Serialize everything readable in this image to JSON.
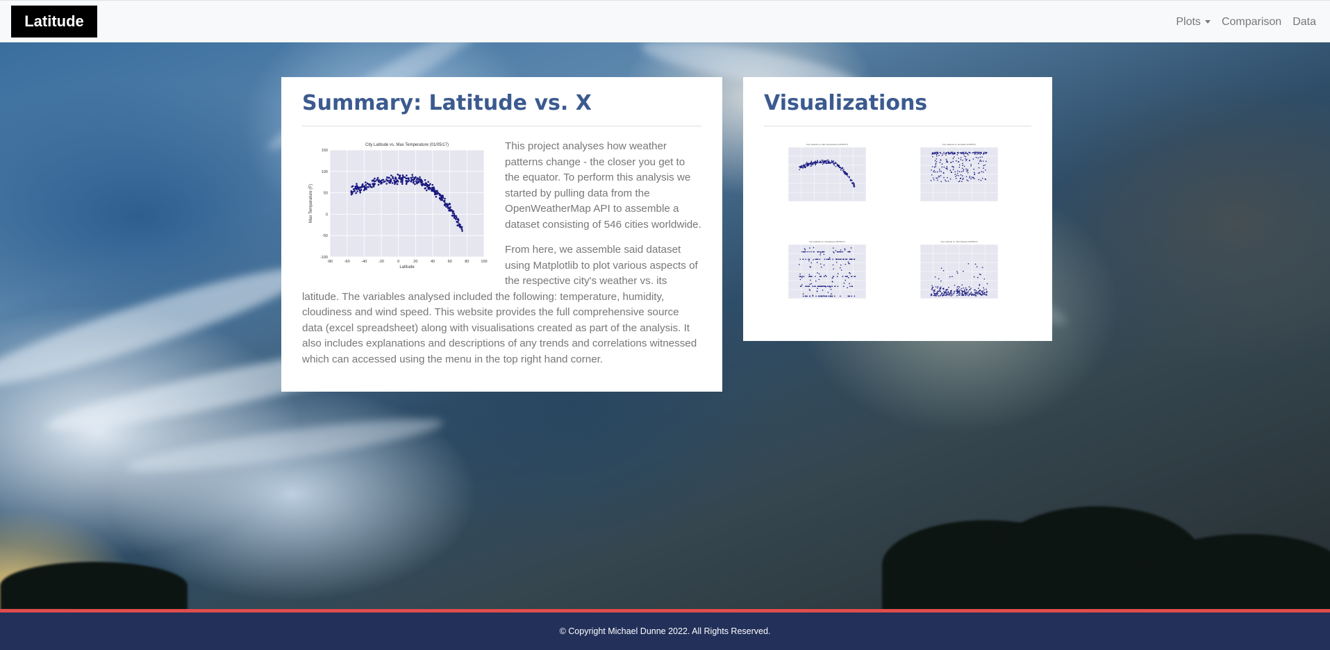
{
  "navbar": {
    "brand": "Latitude",
    "links": [
      {
        "label": "Plots",
        "has_dropdown": true
      },
      {
        "label": "Comparison"
      },
      {
        "label": "Data"
      }
    ]
  },
  "summary": {
    "title": "Summary: Latitude vs. X",
    "paragraphs": [
      "This project analyses how weather patterns change - the closer you get to the equator. To perform this analysis we started by pulling data from the OpenWeatherMap API to assemble a dataset consisting of 546 cities worldwide.",
      "From here, we assemble said dataset using Matplotlib to plot various aspects of the respective city's weather vs. its latitude. The variables analysed included the following: temperature, humidity, cloudiness and wind speed. This website provides the full comprehensive source data (excel spreadsheet) along with visualisations created as part of the analysis. It also includes explanations and descriptions of any trends and correlations witnessed which can accessed using the menu in the top right hand corner."
    ]
  },
  "visualizations": {
    "title": "Visualizations"
  },
  "chart_data": [
    {
      "type": "scatter",
      "title": "City Latitude vs. Max Temperature (01/05/17)",
      "xlabel": "Latitude",
      "ylabel": "Max Temperature (F)",
      "xlim": [
        -80,
        100
      ],
      "ylim": [
        -100,
        150
      ],
      "xticks": [
        -80,
        -60,
        -40,
        -20,
        0,
        20,
        40,
        60,
        80,
        100
      ],
      "yticks": [
        150,
        100,
        50,
        0,
        -50,
        -100
      ],
      "grid": true,
      "point_color": "#1a1a80",
      "trend": "max temperature peaks around latitude -20 to 10 (about 75-90 F) and falls steeply toward high northern latitudes (down to about -50 F near latitude 75)"
    },
    {
      "type": "scatter",
      "title": "City Latitude vs. Max Temperature (01/05/17)",
      "thumbnail": true
    },
    {
      "type": "scatter",
      "title": "City Latitude vs. Humidity (01/05/17)",
      "thumbnail": true
    },
    {
      "type": "scatter",
      "title": "City Latitude vs. Cloudiness (01/05/17)",
      "thumbnail": true
    },
    {
      "type": "scatter",
      "title": "City Latitude vs. Wind Speed (01/05/17)",
      "thumbnail": true
    }
  ],
  "footer": {
    "text": "© Copyright Michael Dunne 2022. All Rights Reserved."
  },
  "colors": {
    "navbar_bg": "#f8f9fa",
    "heading": "#3b5a8f",
    "footer_bg": "#22305a",
    "footer_accent": "#e04d4d",
    "scatter_points": "#1a1a80"
  }
}
